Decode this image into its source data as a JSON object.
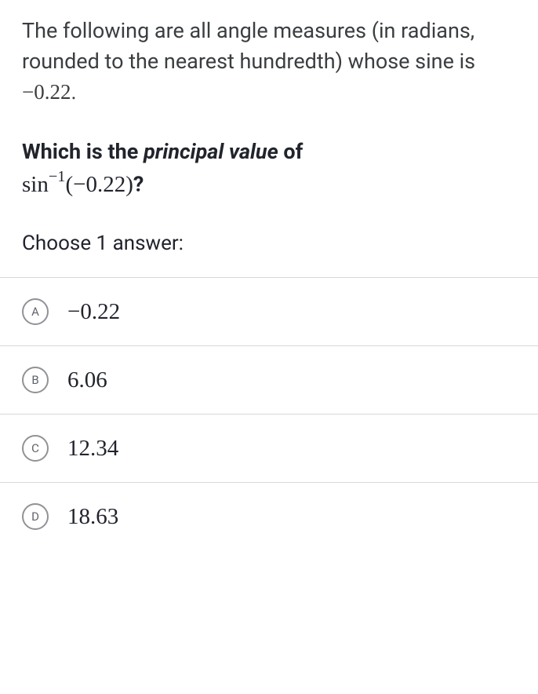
{
  "question": {
    "intro_part1": "The following are all angle measures (in radians, rounded to the nearest hundredth) whose sine is ",
    "intro_value": "−0.22",
    "intro_part2": ".",
    "main_part1": "Which is the ",
    "main_emphasis": "principal value",
    "main_part2": " of",
    "expr_func": "sin",
    "expr_sup": "−1",
    "expr_arg": "(−0.22)",
    "expr_end": "?"
  },
  "choose_label": "Choose 1 answer:",
  "options": [
    {
      "letter": "A",
      "text": "−0.22"
    },
    {
      "letter": "B",
      "text": "6.06"
    },
    {
      "letter": "C",
      "text": "12.34"
    },
    {
      "letter": "D",
      "text": "18.63"
    }
  ]
}
